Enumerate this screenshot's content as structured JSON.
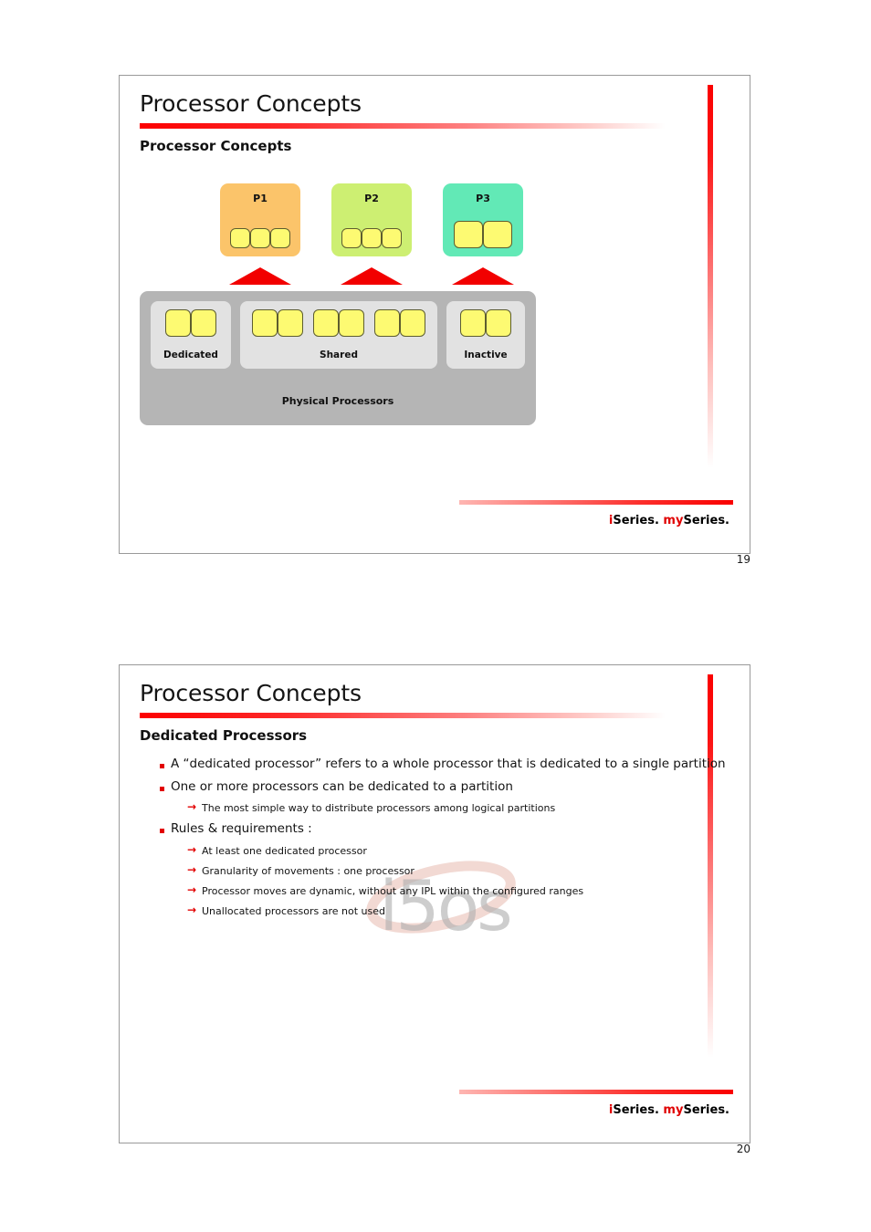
{
  "document": {
    "page_background": "#ffffff",
    "accent_red": "#e20000"
  },
  "slides": [
    {
      "title": "Processor Concepts",
      "subtitle": "Processor Concepts",
      "page_number": "19",
      "footer": {
        "prefix": "i",
        "brand_1": "Series. ",
        "accent_2": "my",
        "brand_2": "Series."
      },
      "diagram": {
        "partitions": [
          {
            "label": "P1",
            "color": "#fbc46a",
            "chip_count": 3,
            "chip_size": "small"
          },
          {
            "label": "P2",
            "color": "#cdef72",
            "chip_count": 3,
            "chip_size": "small"
          },
          {
            "label": "P3",
            "color": "#62e9b6",
            "chip_count": 2,
            "chip_size": "large"
          }
        ],
        "arrows": [
          {
            "name": "arrow-to-p1",
            "color": "#f20000"
          },
          {
            "name": "arrow-to-p2",
            "color": "#f20000"
          },
          {
            "name": "arrow-to-p3",
            "color": "#f20000"
          }
        ],
        "physical_bar": {
          "label": "Physical Processors",
          "color": "#b5b5b5",
          "groups": [
            {
              "label": "Dedicated",
              "pairs": 1,
              "chips_per_pair": 2,
              "total_chips": 2
            },
            {
              "label": "Shared",
              "pairs": 3,
              "chips_per_pair": 2,
              "total_chips": 6
            },
            {
              "label": "Inactive",
              "pairs": 1,
              "chips_per_pair": 2,
              "total_chips": 2
            }
          ],
          "chip_color": "#fdfa72"
        }
      }
    },
    {
      "title": "Processor Concepts",
      "subtitle": "Dedicated Processors",
      "page_number": "20",
      "footer": {
        "prefix": "i",
        "brand_1": "Series. ",
        "accent_2": "my",
        "brand_2": "Series."
      },
      "bullets": [
        {
          "level": 1,
          "text": "A “dedicated processor” refers to a whole processor that is dedicated to a single partition"
        },
        {
          "level": 1,
          "text": "One or more processors can be dedicated to a partition"
        },
        {
          "level": 2,
          "text": "The most simple way to distribute processors among logical partitions"
        },
        {
          "level": 1,
          "text": "Rules & requirements :"
        },
        {
          "level": 2,
          "text": "At least one dedicated processor"
        },
        {
          "level": 2,
          "text": "Granularity of movements : one processor"
        },
        {
          "level": 2,
          "text": "Processor moves are dynamic, without any IPL within the configured ranges"
        },
        {
          "level": 2,
          "text": "Unallocated processors are not used"
        }
      ],
      "watermark": {
        "text": "i5os",
        "glyph_color": "#b0b0b0",
        "swoosh_color": "#e8b9ae"
      }
    }
  ]
}
